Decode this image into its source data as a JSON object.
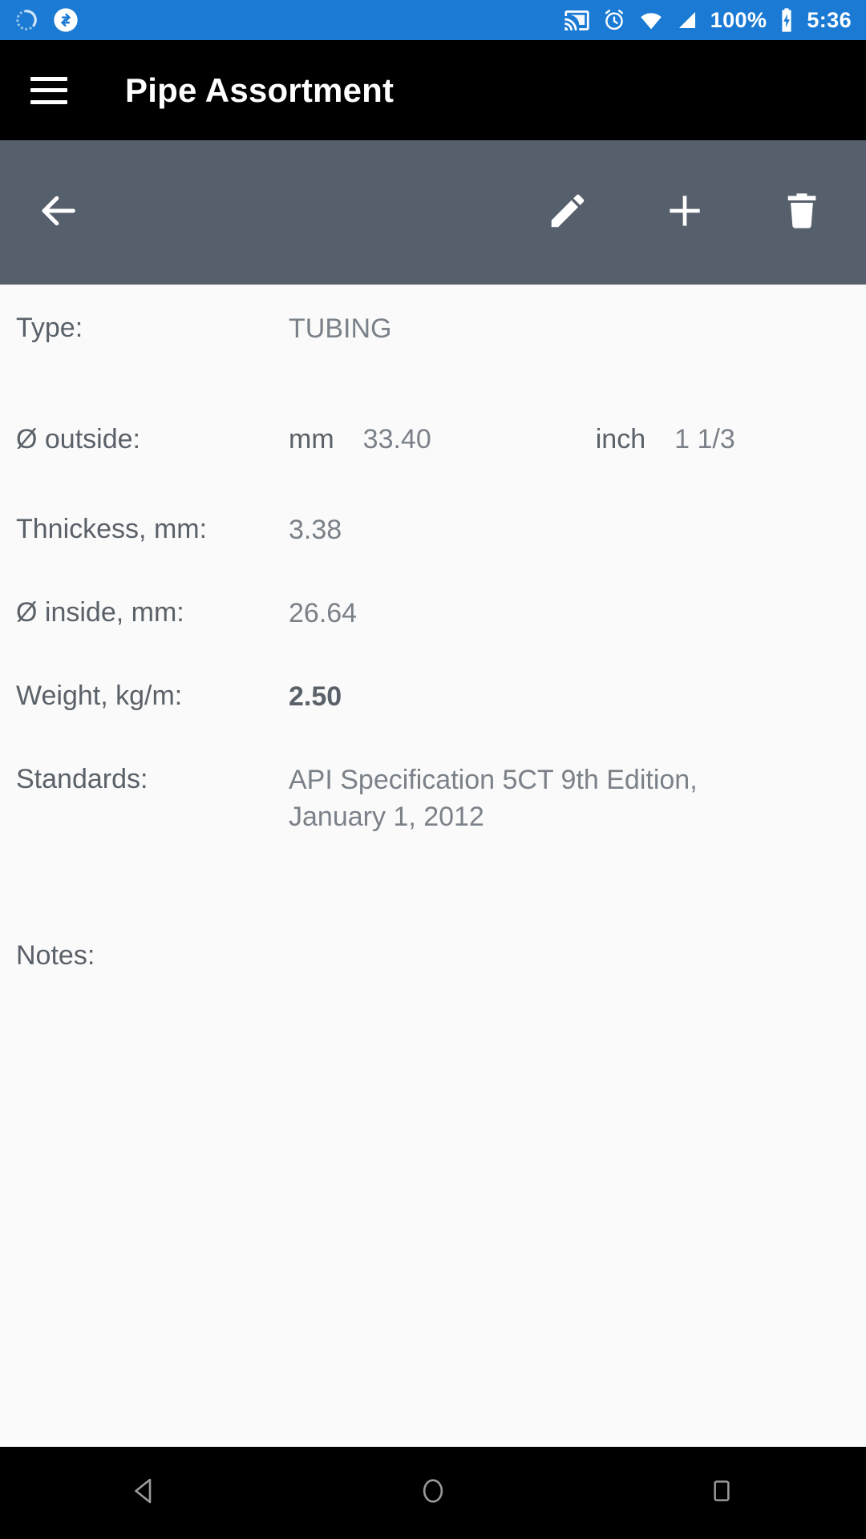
{
  "status_bar": {
    "background": "#1a7ad4",
    "left_icons": [
      {
        "name": "progress-spinner-icon",
        "label": "loading"
      },
      {
        "name": "sync-icon",
        "label": "sync"
      }
    ],
    "right_icons": [
      {
        "name": "cast-icon",
        "label": "cast"
      },
      {
        "name": "alarm-icon",
        "label": "alarm"
      },
      {
        "name": "wifi-icon",
        "label": "wifi"
      },
      {
        "name": "signal-icon",
        "label": "cellular signal"
      }
    ],
    "battery_percent": "100%",
    "battery_state": "charging",
    "time": "5:36"
  },
  "app_bar": {
    "background": "#000000",
    "menu_icon": "hamburger-menu-icon",
    "title": "Pipe Assortment"
  },
  "action_bar": {
    "background": "#56606d",
    "back_icon": "arrow-back-icon",
    "actions": [
      {
        "name": "edit-button",
        "icon": "pencil-icon",
        "label": "Edit"
      },
      {
        "name": "add-button",
        "icon": "plus-icon",
        "label": "Add"
      },
      {
        "name": "delete-button",
        "icon": "trash-icon",
        "label": "Delete"
      }
    ]
  },
  "details": {
    "type": {
      "label": "Type:",
      "value": "TUBING"
    },
    "outside": {
      "label": "Ø outside:",
      "mm_label": "mm",
      "mm_value": "33.40",
      "inch_label": "inch",
      "inch_value": "1 1/3"
    },
    "thickness": {
      "label": "Thnickess, mm:",
      "value": "3.38"
    },
    "inside": {
      "label": "Ø inside, mm:",
      "value": "26.64"
    },
    "weight": {
      "label": "Weight, kg/m:",
      "value": "2.50"
    },
    "standards": {
      "label": "Standards:",
      "value": "API Specification 5CT 9th Edition, January 1, 2012"
    },
    "notes": {
      "label": "Notes:",
      "value": ""
    }
  },
  "nav_bar": {
    "background": "#000000",
    "buttons": [
      {
        "name": "nav-back-button",
        "icon": "triangle-back-icon"
      },
      {
        "name": "nav-home-button",
        "icon": "circle-home-icon"
      },
      {
        "name": "nav-recents-button",
        "icon": "square-recents-icon"
      }
    ]
  }
}
